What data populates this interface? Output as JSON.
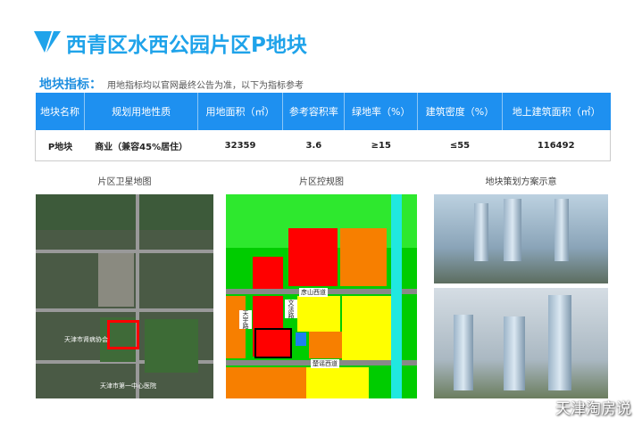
{
  "title": "西青区水西公园片区P地块",
  "indicator_label": "地块指标：",
  "indicator_note": "用地指标均以官网最终公告为准，以下为指标参考",
  "table": {
    "headers": [
      "地块名称",
      "规划用地性质",
      "用地面积（㎡）",
      "参考容积率",
      "绿地率（%）",
      "建筑密度（%）",
      "地上建筑面积（㎡）"
    ],
    "rows": [
      [
        "P地块",
        "商业（兼容45%居住）",
        "32359",
        "3.6",
        "≥15",
        "≤55",
        "116492"
      ]
    ]
  },
  "captions": {
    "satellite": "片区卫星地图",
    "plan": "片区控规图",
    "render": "地块策划方案示意"
  },
  "plan_roads": [
    "彦山西道",
    "天宇路",
    "文法路",
    "楚谣西道"
  ],
  "satellite_labels": [
    "天津市肾病协会",
    "天津市第一中心医院"
  ],
  "watermark": "天津淘房说",
  "colors": {
    "accent": "#1e90f0"
  }
}
